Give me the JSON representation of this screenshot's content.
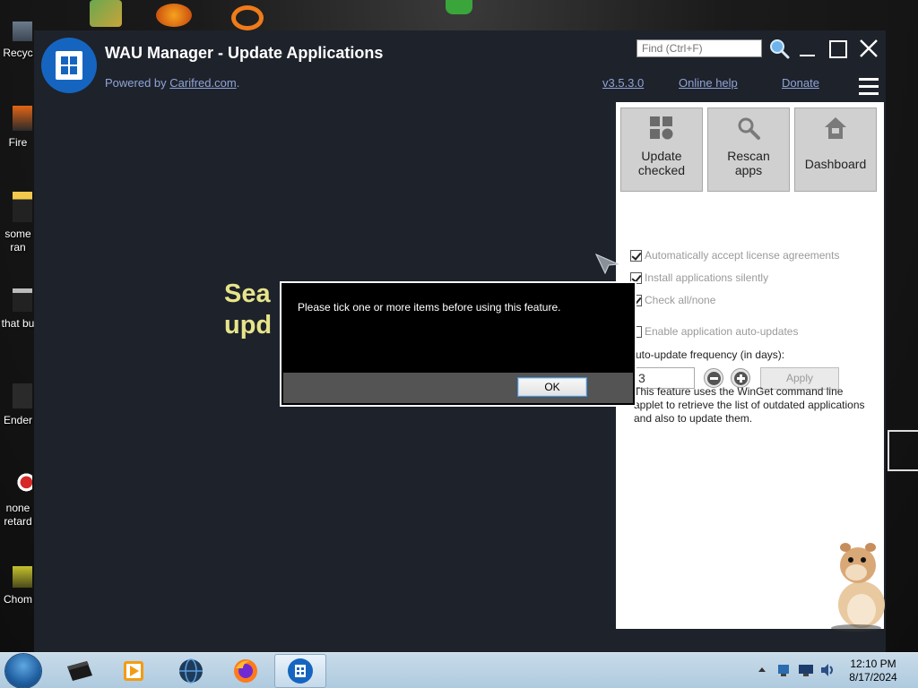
{
  "desktop": {
    "icons": [
      {
        "label": "Recyc",
        "name": "desktop-icon-recycle-bin"
      },
      {
        "label": "Fire",
        "name": "desktop-icon-fire"
      },
      {
        "label": "some ran",
        "name": "desktop-icon-some-ran"
      },
      {
        "label": "that bu",
        "name": "desktop-icon-that-bu"
      },
      {
        "label": "Ender",
        "name": "desktop-icon-ender"
      },
      {
        "label": "none retard",
        "name": "desktop-icon-none-retard"
      },
      {
        "label": "Chom",
        "name": "desktop-icon-chom"
      }
    ]
  },
  "window": {
    "title": "WAU Manager - Update Applications",
    "powered_prefix": "Powered by ",
    "powered_link": "Carifred.com",
    "powered_suffix": ".",
    "version": "v3.5.3.0",
    "online_help": "Online help",
    "donate": "Donate",
    "find_placeholder": "Find (Ctrl+F)"
  },
  "panel": {
    "buttons": [
      {
        "label_line1": "Update",
        "label_line2": "checked",
        "icon": "grid-icon"
      },
      {
        "label_line1": "Rescan",
        "label_line2": "apps",
        "icon": "magnifier-icon"
      },
      {
        "label_line1": "Dashboard",
        "label_line2": "",
        "icon": "home-icon"
      }
    ],
    "options": [
      {
        "label": "Automatically accept license agreements",
        "checked": true
      },
      {
        "label": "Install applications silently",
        "checked": true
      },
      {
        "label": "Check all/none",
        "checked": true
      },
      {
        "label": "Enable application auto-updates",
        "checked": false
      }
    ],
    "freq_label": "uto-update frequency (in days):",
    "freq_value": "3",
    "apply": "Apply",
    "info": "This feature uses the WinGet command line applet to retrieve the list of outdated applications and also to update them."
  },
  "main": {
    "heading_line1": "Sea",
    "heading_line2": "upd"
  },
  "dialog": {
    "message": "Please tick one or more items before using this feature.",
    "ok": "OK"
  },
  "taskbar": {
    "time": "12:10 PM",
    "date": "8/17/2024",
    "apps": [
      "file-manager-icon",
      "media-player-icon",
      "globe-icon",
      "firefox-icon",
      "wau-manager-icon"
    ]
  },
  "colors": {
    "app_bg": "#1e222b",
    "accent": "#1565c0",
    "link": "#8fa4d6",
    "heading": "#e7e48a"
  }
}
